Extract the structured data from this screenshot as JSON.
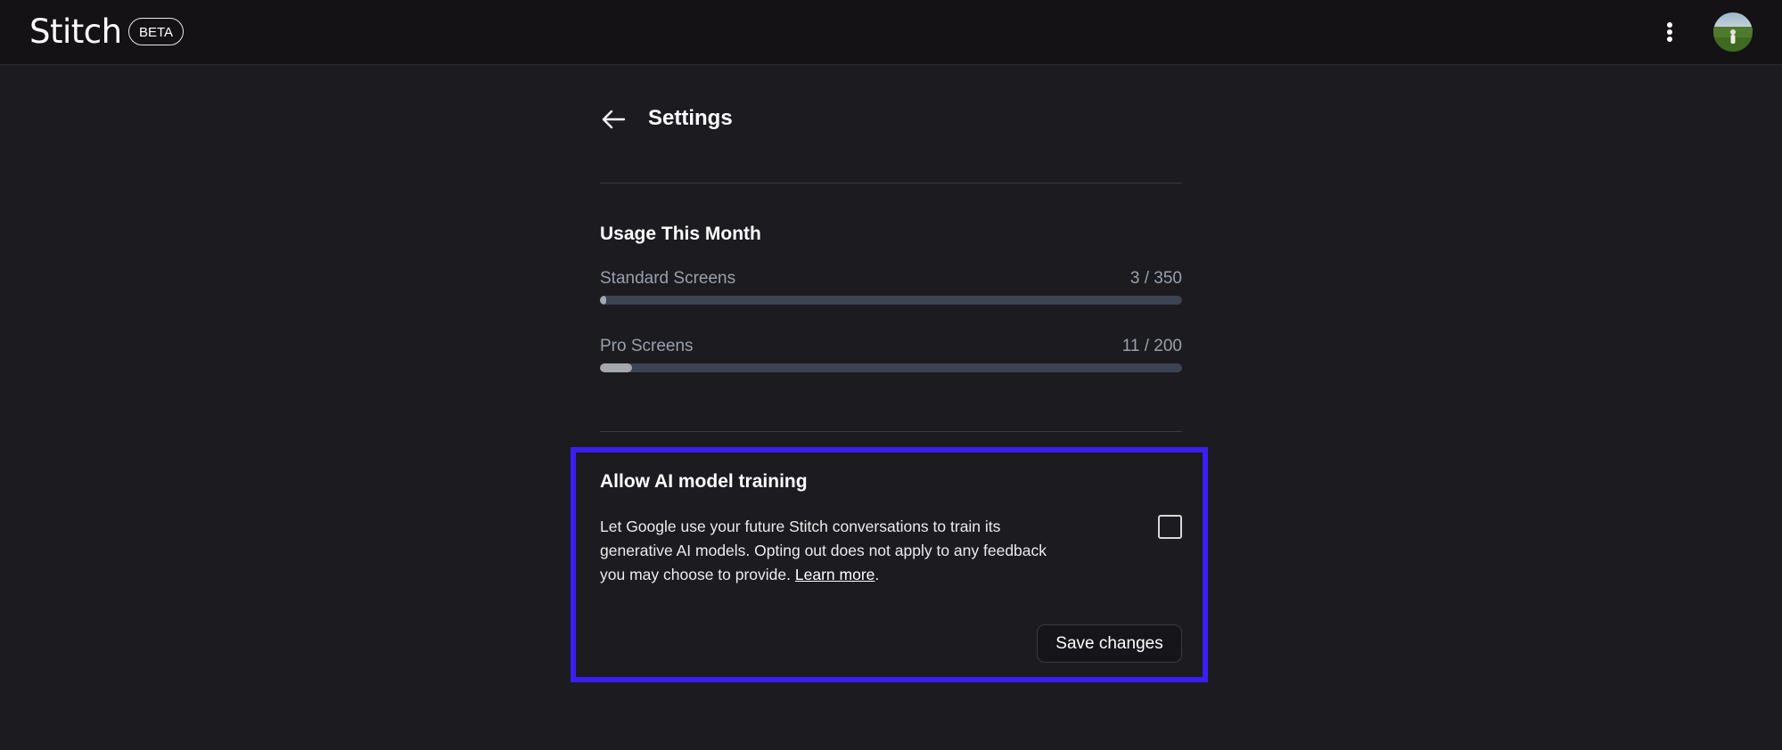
{
  "app": {
    "name": "Stitch",
    "badge": "BETA"
  },
  "header": {
    "more_icon": "more-vertical-icon",
    "avatar_icon": "user-avatar"
  },
  "settings": {
    "back_icon": "arrow-left-icon",
    "title": "Settings"
  },
  "usage": {
    "title": "Usage This Month",
    "items": [
      {
        "label": "Standard Screens",
        "count": "3 / 350",
        "used": 3,
        "limit": 350
      },
      {
        "label": "Pro Screens",
        "count": "11 / 200",
        "used": 11,
        "limit": 200
      }
    ]
  },
  "ai_training": {
    "title": "Allow AI model training",
    "description": "Let Google use your future Stitch conversations to train its generative AI models. Opting out does not apply to any feedback you may choose to provide.",
    "learn_more": "Learn more",
    "checked": false,
    "save_label": "Save changes"
  },
  "colors": {
    "background": "#1b1b20",
    "topbar": "#141215",
    "highlight_border": "#3a1ff0",
    "progress_track": "#3c4352",
    "progress_fill": "#a6a8ad"
  }
}
